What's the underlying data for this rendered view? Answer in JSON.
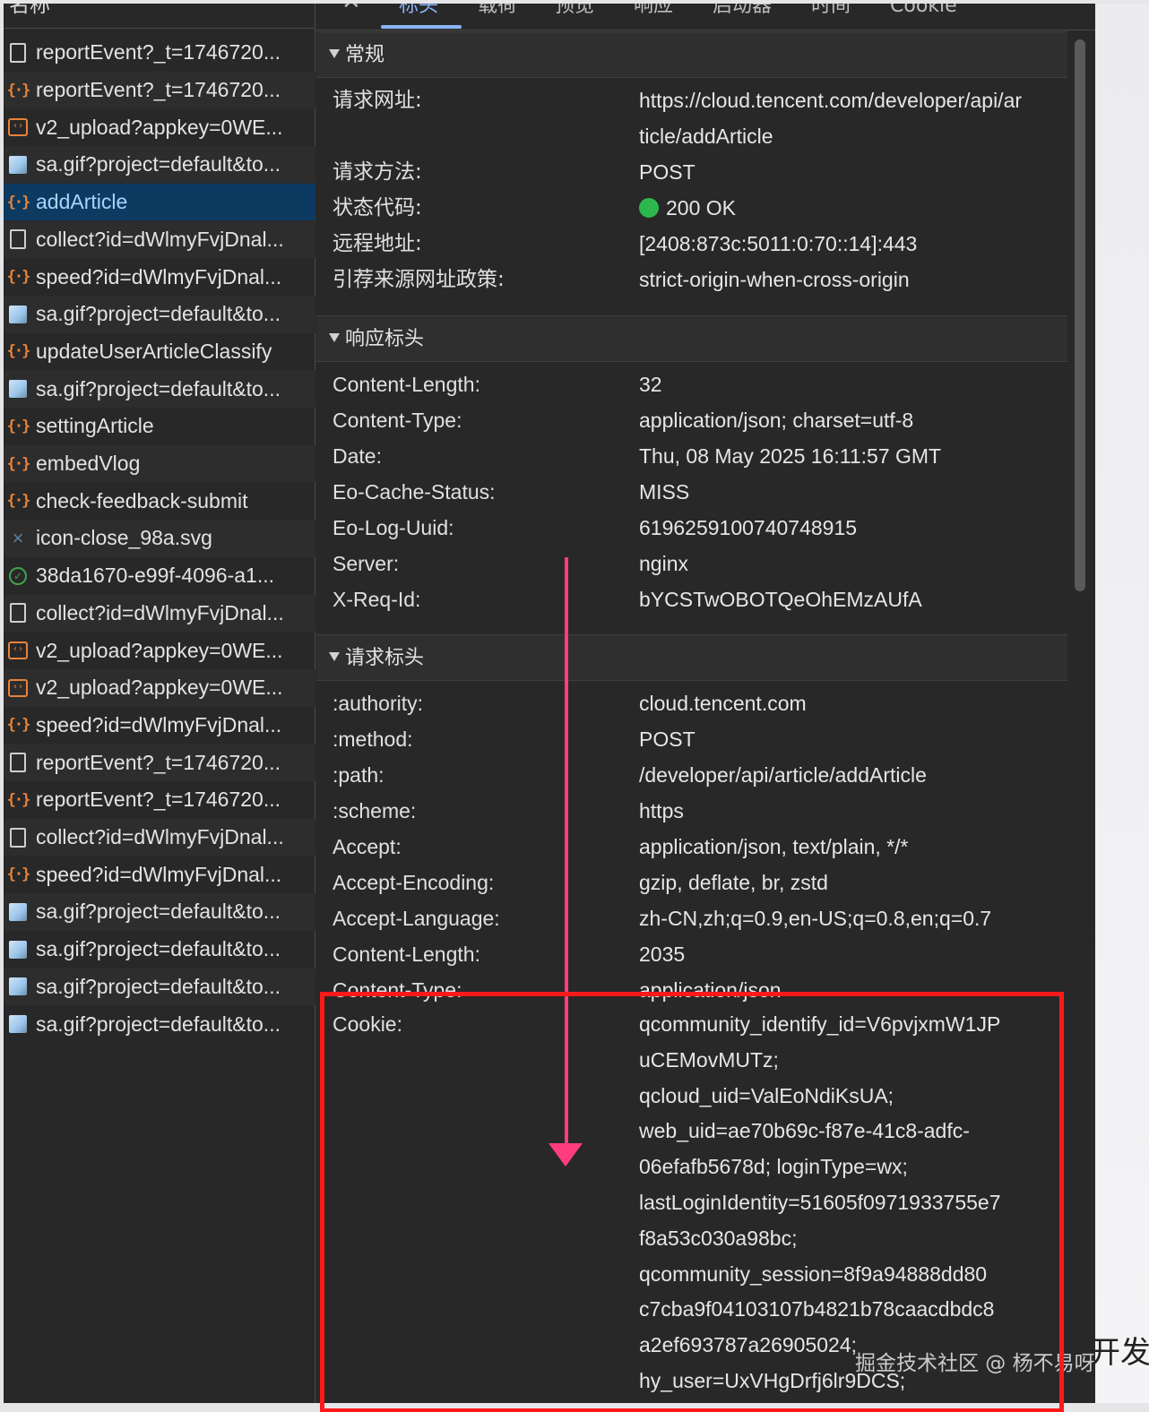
{
  "list": {
    "header": "名称",
    "rows": [
      {
        "icon": "doc",
        "label": "reportEvent?_t=1746720..."
      },
      {
        "icon": "json",
        "label": "reportEvent?_t=1746720..."
      },
      {
        "icon": "script",
        "label": "v2_upload?appkey=0WE..."
      },
      {
        "icon": "image",
        "label": "sa.gif?project=default&to..."
      },
      {
        "icon": "json",
        "label": "addArticle",
        "selected": true
      },
      {
        "icon": "doc",
        "label": "collect?id=dWlmyFvjDnal..."
      },
      {
        "icon": "json",
        "label": "speed?id=dWlmyFvjDnal..."
      },
      {
        "icon": "image",
        "label": "sa.gif?project=default&to..."
      },
      {
        "icon": "json",
        "label": "updateUserArticleClassify"
      },
      {
        "icon": "image",
        "label": "sa.gif?project=default&to..."
      },
      {
        "icon": "json",
        "label": "settingArticle"
      },
      {
        "icon": "json",
        "label": "embedVlog"
      },
      {
        "icon": "json",
        "label": "check-feedback-submit"
      },
      {
        "icon": "x",
        "label": "icon-close_98a.svg"
      },
      {
        "icon": "ok",
        "label": "38da1670-e99f-4096-a1..."
      },
      {
        "icon": "doc",
        "label": "collect?id=dWlmyFvjDnal..."
      },
      {
        "icon": "script",
        "label": "v2_upload?appkey=0WE..."
      },
      {
        "icon": "script",
        "label": "v2_upload?appkey=0WE..."
      },
      {
        "icon": "json",
        "label": "speed?id=dWlmyFvjDnal..."
      },
      {
        "icon": "doc",
        "label": "reportEvent?_t=1746720..."
      },
      {
        "icon": "json",
        "label": "reportEvent?_t=1746720..."
      },
      {
        "icon": "doc",
        "label": "collect?id=dWlmyFvjDnal..."
      },
      {
        "icon": "json",
        "label": "speed?id=dWlmyFvjDnal..."
      },
      {
        "icon": "image",
        "label": "sa.gif?project=default&to..."
      },
      {
        "icon": "image",
        "label": "sa.gif?project=default&to..."
      },
      {
        "icon": "image",
        "label": "sa.gif?project=default&to..."
      },
      {
        "icon": "image",
        "label": "sa.gif?project=default&to..."
      }
    ]
  },
  "tabs": {
    "close": "✕",
    "items": [
      "标头",
      "载荷",
      "预览",
      "响应",
      "启动器",
      "时间",
      "Cookie"
    ],
    "active": "标头"
  },
  "general": {
    "title": "常规",
    "url_label": "请求网址:",
    "url_line1": "https://cloud.tencent.com/developer/api/ar",
    "url_line2": "ticle/addArticle",
    "method_label": "请求方法:",
    "method": "POST",
    "status_label": "状态代码:",
    "status": "200 OK",
    "remote_label": "远程地址:",
    "remote": "[2408:873c:5011:0:70::14]:443",
    "referrer_label": "引荐来源网址政策:",
    "referrer": "strict-origin-when-cross-origin"
  },
  "response_headers": {
    "title": "响应标头",
    "rows": [
      {
        "name": "Content-Length:",
        "value": "32"
      },
      {
        "name": "Content-Type:",
        "value": "application/json; charset=utf-8"
      },
      {
        "name": "Date:",
        "value": "Thu, 08 May 2025 16:11:57 GMT"
      },
      {
        "name": "Eo-Cache-Status:",
        "value": "MISS"
      },
      {
        "name": "Eo-Log-Uuid:",
        "value": "6196259100740748915"
      },
      {
        "name": "Server:",
        "value": "nginx"
      },
      {
        "name": "X-Req-Id:",
        "value": "bYCSTwOBOTQeOhEMzAUfA"
      }
    ]
  },
  "request_headers": {
    "title": "请求标头",
    "rows": [
      {
        "name": ":authority:",
        "value": "cloud.tencent.com"
      },
      {
        "name": ":method:",
        "value": "POST"
      },
      {
        "name": ":path:",
        "value": "/developer/api/article/addArticle"
      },
      {
        "name": ":scheme:",
        "value": "https"
      },
      {
        "name": "Accept:",
        "value": "application/json, text/plain, */*"
      },
      {
        "name": "Accept-Encoding:",
        "value": "gzip, deflate, br, zstd"
      },
      {
        "name": "Accept-Language:",
        "value": "zh-CN,zh;q=0.9,en-US;q=0.8,en;q=0.7"
      },
      {
        "name": "Content-Length:",
        "value": "2035"
      },
      {
        "name": "Content-Type:",
        "value": "application/json"
      }
    ],
    "cookie_label": "Cookie:",
    "cookie_lines": [
      "qcommunity_identify_id=V6pvjxmW1JP",
      "uCEMovMUTz;",
      "qcloud_uid=ValEoNdiKsUA;",
      "web_uid=ae70b69c-f87e-41c8-adfc-",
      "06efafb5678d; loginType=wx;",
      "lastLoginIdentity=51605f0971933755e7",
      "f8a53c030a98bc;",
      "qcommunity_session=8f9a94888dd80",
      "c7cba9f04103107b4821b78caacdbdc8",
      "a2ef693787a26905024;",
      "hy_user=UxVHgDrfj6lr9DCS;"
    ]
  },
  "watermark": "掘金技术社区 @ 杨不易呀",
  "edge_text": "开发者",
  "colors": {
    "selected_row": "#0d3a61",
    "accent": "#8ab4f8",
    "status_ok": "#2db84d",
    "highlight": "#ff1a1a",
    "arrow": "#ff3d7f"
  }
}
